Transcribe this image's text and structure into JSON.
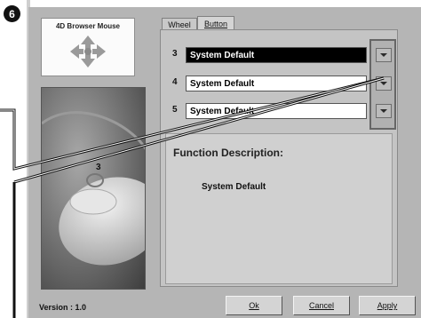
{
  "step_badge": "6",
  "logo": {
    "title": "4D Browser Mouse",
    "icon": "four-way-arrows-icon"
  },
  "mouse_image": {
    "button_number": "3"
  },
  "tabs": [
    {
      "label": "Wheel",
      "active": false
    },
    {
      "label": "Button",
      "active": true
    }
  ],
  "rows": [
    {
      "number": "3",
      "value": "System Default",
      "selected": true
    },
    {
      "number": "4",
      "value": "System Default",
      "selected": false
    },
    {
      "number": "5",
      "value": "System Default",
      "selected": false
    }
  ],
  "function_description": {
    "title": "Function Description:",
    "text": "System Default"
  },
  "footer": {
    "version": "Version : 1.0",
    "ok_label": "Ok",
    "cancel_label": "Cancel",
    "apply_label": "Apply"
  },
  "colors": {
    "dialog_bg": "#b5b5b5",
    "panel_bg": "#c4c4c4",
    "selection": "#000000"
  }
}
